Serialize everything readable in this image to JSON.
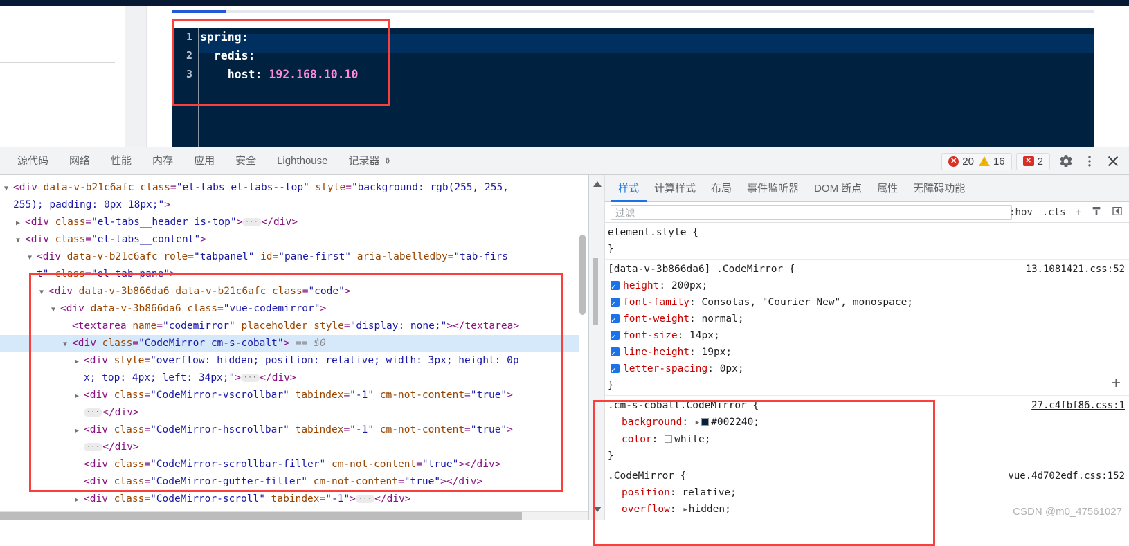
{
  "page": {
    "editor": {
      "theme_class": "cm-s-cobalt",
      "background": "#002240",
      "lines": [
        {
          "num": "1",
          "key": "spring:",
          "value": ""
        },
        {
          "num": "2",
          "key": "  redis:",
          "value": ""
        },
        {
          "num": "3",
          "key": "    host: ",
          "value": "192.168.10.10"
        }
      ]
    }
  },
  "devtools": {
    "tabs": [
      {
        "label": "源代码"
      },
      {
        "label": "网络"
      },
      {
        "label": "性能"
      },
      {
        "label": "内存"
      },
      {
        "label": "应用"
      },
      {
        "label": "安全"
      },
      {
        "label": "Lighthouse"
      },
      {
        "label": "记录器",
        "icon": "⚱"
      }
    ],
    "counters": {
      "errors": "20",
      "warnings": "16",
      "issues": "2",
      "error_glyph": "✕",
      "warning_glyph": "!",
      "issue_glyph": "✕"
    },
    "actions": {
      "settings": "⚙",
      "more": "⋮",
      "close": "✕"
    },
    "dom_tree": [
      {
        "indent": 0,
        "twisty": "▼",
        "segments": [
          {
            "t": "pt",
            "s": "<"
          },
          {
            "t": "tg",
            "s": "div"
          },
          {
            "t": "plain",
            "s": " "
          },
          {
            "t": "at",
            "s": "data-v-b21c6afc"
          },
          {
            "t": "plain",
            "s": " "
          },
          {
            "t": "at",
            "s": "class"
          },
          {
            "t": "pt",
            "s": "="
          },
          {
            "t": "av",
            "s": "\"el-tabs el-tabs--top\""
          },
          {
            "t": "plain",
            "s": " "
          },
          {
            "t": "at",
            "s": "style"
          },
          {
            "t": "pt",
            "s": "="
          },
          {
            "t": "av",
            "s": "\"background: rgb(255, 255,"
          }
        ]
      },
      {
        "indent": 0,
        "twisty": "",
        "segments": [
          {
            "t": "av",
            "s": "255); padding: 0px 18px;\""
          },
          {
            "t": "pt",
            "s": ">"
          }
        ]
      },
      {
        "indent": 1,
        "twisty": "▶",
        "segments": [
          {
            "t": "pt",
            "s": "<"
          },
          {
            "t": "tg",
            "s": "div"
          },
          {
            "t": "plain",
            "s": " "
          },
          {
            "t": "at",
            "s": "class"
          },
          {
            "t": "pt",
            "s": "="
          },
          {
            "t": "av",
            "s": "\"el-tabs__header is-top\""
          },
          {
            "t": "pt",
            "s": ">"
          },
          {
            "t": "ell",
            "s": "…"
          },
          {
            "t": "pt",
            "s": "</"
          },
          {
            "t": "tg",
            "s": "div"
          },
          {
            "t": "pt",
            "s": ">"
          }
        ]
      },
      {
        "indent": 1,
        "twisty": "▼",
        "segments": [
          {
            "t": "pt",
            "s": "<"
          },
          {
            "t": "tg",
            "s": "div"
          },
          {
            "t": "plain",
            "s": " "
          },
          {
            "t": "at",
            "s": "class"
          },
          {
            "t": "pt",
            "s": "="
          },
          {
            "t": "av",
            "s": "\"el-tabs__content\""
          },
          {
            "t": "pt",
            "s": ">"
          }
        ]
      },
      {
        "indent": 2,
        "twisty": "▼",
        "segments": [
          {
            "t": "pt",
            "s": "<"
          },
          {
            "t": "tg",
            "s": "div"
          },
          {
            "t": "plain",
            "s": " "
          },
          {
            "t": "at",
            "s": "data-v-b21c6afc"
          },
          {
            "t": "plain",
            "s": " "
          },
          {
            "t": "at",
            "s": "role"
          },
          {
            "t": "pt",
            "s": "="
          },
          {
            "t": "av",
            "s": "\"tabpanel\""
          },
          {
            "t": "plain",
            "s": " "
          },
          {
            "t": "at",
            "s": "id"
          },
          {
            "t": "pt",
            "s": "="
          },
          {
            "t": "av",
            "s": "\"pane-first\""
          },
          {
            "t": "plain",
            "s": " "
          },
          {
            "t": "at",
            "s": "aria-labelledby"
          },
          {
            "t": "pt",
            "s": "="
          },
          {
            "t": "av",
            "s": "\"tab-firs"
          }
        ]
      },
      {
        "indent": 2,
        "twisty": "",
        "segments": [
          {
            "t": "av",
            "s": "t\""
          },
          {
            "t": "plain",
            "s": " "
          },
          {
            "t": "at",
            "s": "class"
          },
          {
            "t": "pt",
            "s": "="
          },
          {
            "t": "av",
            "s": "\"el-tab-pane\""
          },
          {
            "t": "pt",
            "s": ">"
          }
        ]
      },
      {
        "indent": 3,
        "twisty": "▼",
        "segments": [
          {
            "t": "pt",
            "s": "<"
          },
          {
            "t": "tg",
            "s": "div"
          },
          {
            "t": "plain",
            "s": " "
          },
          {
            "t": "at",
            "s": "data-v-3b866da6"
          },
          {
            "t": "plain",
            "s": " "
          },
          {
            "t": "at",
            "s": "data-v-b21c6afc"
          },
          {
            "t": "plain",
            "s": " "
          },
          {
            "t": "at",
            "s": "class"
          },
          {
            "t": "pt",
            "s": "="
          },
          {
            "t": "av",
            "s": "\"code\""
          },
          {
            "t": "pt",
            "s": ">"
          }
        ]
      },
      {
        "indent": 4,
        "twisty": "▼",
        "segments": [
          {
            "t": "pt",
            "s": "<"
          },
          {
            "t": "tg",
            "s": "div"
          },
          {
            "t": "plain",
            "s": " "
          },
          {
            "t": "at",
            "s": "data-v-3b866da6"
          },
          {
            "t": "plain",
            "s": " "
          },
          {
            "t": "at",
            "s": "class"
          },
          {
            "t": "pt",
            "s": "="
          },
          {
            "t": "av",
            "s": "\"vue-codemirror\""
          },
          {
            "t": "pt",
            "s": ">"
          }
        ]
      },
      {
        "indent": 5,
        "twisty": "",
        "segments": [
          {
            "t": "pt",
            "s": "<"
          },
          {
            "t": "tg",
            "s": "textarea"
          },
          {
            "t": "plain",
            "s": " "
          },
          {
            "t": "at",
            "s": "name"
          },
          {
            "t": "pt",
            "s": "="
          },
          {
            "t": "av",
            "s": "\"codemirror\""
          },
          {
            "t": "plain",
            "s": " "
          },
          {
            "t": "at",
            "s": "placeholder"
          },
          {
            "t": "plain",
            "s": " "
          },
          {
            "t": "at",
            "s": "style"
          },
          {
            "t": "pt",
            "s": "="
          },
          {
            "t": "av",
            "s": "\"display: none;\""
          },
          {
            "t": "pt",
            "s": "></"
          },
          {
            "t": "tg",
            "s": "textarea"
          },
          {
            "t": "pt",
            "s": ">"
          }
        ]
      },
      {
        "indent": 5,
        "twisty": "▼",
        "selected": true,
        "segments": [
          {
            "t": "pt",
            "s": "<"
          },
          {
            "t": "tg",
            "s": "div"
          },
          {
            "t": "plain",
            "s": " "
          },
          {
            "t": "at",
            "s": "class"
          },
          {
            "t": "pt",
            "s": "="
          },
          {
            "t": "av",
            "s": "\"CodeMirror cm-s-cobalt\""
          },
          {
            "t": "pt",
            "s": ">"
          },
          {
            "t": "eq",
            "s": " == $0"
          }
        ]
      },
      {
        "indent": 6,
        "twisty": "▶",
        "segments": [
          {
            "t": "pt",
            "s": "<"
          },
          {
            "t": "tg",
            "s": "div"
          },
          {
            "t": "plain",
            "s": " "
          },
          {
            "t": "at",
            "s": "style"
          },
          {
            "t": "pt",
            "s": "="
          },
          {
            "t": "av",
            "s": "\"overflow: hidden; position: relative; width: 3px; height: 0p"
          }
        ]
      },
      {
        "indent": 6,
        "twisty": "",
        "segments": [
          {
            "t": "av",
            "s": "x; top: 4px; left: 34px;\""
          },
          {
            "t": "pt",
            "s": ">"
          },
          {
            "t": "ell",
            "s": "…"
          },
          {
            "t": "pt",
            "s": "</"
          },
          {
            "t": "tg",
            "s": "div"
          },
          {
            "t": "pt",
            "s": ">"
          }
        ]
      },
      {
        "indent": 6,
        "twisty": "▶",
        "segments": [
          {
            "t": "pt",
            "s": "<"
          },
          {
            "t": "tg",
            "s": "div"
          },
          {
            "t": "plain",
            "s": " "
          },
          {
            "t": "at",
            "s": "class"
          },
          {
            "t": "pt",
            "s": "="
          },
          {
            "t": "av",
            "s": "\"CodeMirror-vscrollbar\""
          },
          {
            "t": "plain",
            "s": " "
          },
          {
            "t": "at",
            "s": "tabindex"
          },
          {
            "t": "pt",
            "s": "="
          },
          {
            "t": "av",
            "s": "\"-1\""
          },
          {
            "t": "plain",
            "s": " "
          },
          {
            "t": "at",
            "s": "cm-not-content"
          },
          {
            "t": "pt",
            "s": "="
          },
          {
            "t": "av",
            "s": "\"true\""
          },
          {
            "t": "pt",
            "s": ">"
          }
        ]
      },
      {
        "indent": 6,
        "twisty": "",
        "segments": [
          {
            "t": "ell",
            "s": "…"
          },
          {
            "t": "pt",
            "s": "</"
          },
          {
            "t": "tg",
            "s": "div"
          },
          {
            "t": "pt",
            "s": ">"
          }
        ]
      },
      {
        "indent": 6,
        "twisty": "▶",
        "segments": [
          {
            "t": "pt",
            "s": "<"
          },
          {
            "t": "tg",
            "s": "div"
          },
          {
            "t": "plain",
            "s": " "
          },
          {
            "t": "at",
            "s": "class"
          },
          {
            "t": "pt",
            "s": "="
          },
          {
            "t": "av",
            "s": "\"CodeMirror-hscrollbar\""
          },
          {
            "t": "plain",
            "s": " "
          },
          {
            "t": "at",
            "s": "tabindex"
          },
          {
            "t": "pt",
            "s": "="
          },
          {
            "t": "av",
            "s": "\"-1\""
          },
          {
            "t": "plain",
            "s": " "
          },
          {
            "t": "at",
            "s": "cm-not-content"
          },
          {
            "t": "pt",
            "s": "="
          },
          {
            "t": "av",
            "s": "\"true\""
          },
          {
            "t": "pt",
            "s": ">"
          }
        ]
      },
      {
        "indent": 6,
        "twisty": "",
        "segments": [
          {
            "t": "ell",
            "s": "…"
          },
          {
            "t": "pt",
            "s": "</"
          },
          {
            "t": "tg",
            "s": "div"
          },
          {
            "t": "pt",
            "s": ">"
          }
        ]
      },
      {
        "indent": 6,
        "twisty": "",
        "segments": [
          {
            "t": "pt",
            "s": "<"
          },
          {
            "t": "tg",
            "s": "div"
          },
          {
            "t": "plain",
            "s": " "
          },
          {
            "t": "at",
            "s": "class"
          },
          {
            "t": "pt",
            "s": "="
          },
          {
            "t": "av",
            "s": "\"CodeMirror-scrollbar-filler\""
          },
          {
            "t": "plain",
            "s": " "
          },
          {
            "t": "at",
            "s": "cm-not-content"
          },
          {
            "t": "pt",
            "s": "="
          },
          {
            "t": "av",
            "s": "\"true\""
          },
          {
            "t": "pt",
            "s": "></"
          },
          {
            "t": "tg",
            "s": "div"
          },
          {
            "t": "pt",
            "s": ">"
          }
        ]
      },
      {
        "indent": 6,
        "twisty": "",
        "segments": [
          {
            "t": "pt",
            "s": "<"
          },
          {
            "t": "tg",
            "s": "div"
          },
          {
            "t": "plain",
            "s": " "
          },
          {
            "t": "at",
            "s": "class"
          },
          {
            "t": "pt",
            "s": "="
          },
          {
            "t": "av",
            "s": "\"CodeMirror-gutter-filler\""
          },
          {
            "t": "plain",
            "s": " "
          },
          {
            "t": "at",
            "s": "cm-not-content"
          },
          {
            "t": "pt",
            "s": "="
          },
          {
            "t": "av",
            "s": "\"true\""
          },
          {
            "t": "pt",
            "s": "></"
          },
          {
            "t": "tg",
            "s": "div"
          },
          {
            "t": "pt",
            "s": ">"
          }
        ]
      },
      {
        "indent": 6,
        "twisty": "▶",
        "segments": [
          {
            "t": "pt",
            "s": "<"
          },
          {
            "t": "tg",
            "s": "div"
          },
          {
            "t": "plain",
            "s": " "
          },
          {
            "t": "at",
            "s": "class"
          },
          {
            "t": "pt",
            "s": "="
          },
          {
            "t": "av",
            "s": "\"CodeMirror-scroll\""
          },
          {
            "t": "plain",
            "s": " "
          },
          {
            "t": "at",
            "s": "tabindex"
          },
          {
            "t": "pt",
            "s": "="
          },
          {
            "t": "av",
            "s": "\"-1\""
          },
          {
            "t": "pt",
            "s": ">"
          },
          {
            "t": "ell",
            "s": "…"
          },
          {
            "t": "pt",
            "s": "</"
          },
          {
            "t": "tg",
            "s": "div"
          },
          {
            "t": "pt",
            "s": ">"
          }
        ]
      }
    ],
    "styles": {
      "tabs": [
        {
          "label": "样式",
          "active": true
        },
        {
          "label": "计算样式",
          "active": false
        },
        {
          "label": "布局",
          "active": false
        },
        {
          "label": "事件监听器",
          "active": false
        },
        {
          "label": "DOM 断点",
          "active": false
        },
        {
          "label": "属性",
          "active": false
        },
        {
          "label": "无障碍功能",
          "active": false
        }
      ],
      "filter_placeholder": "过滤",
      "filter_value": "",
      "toolbar": [
        {
          "label": ":hov"
        },
        {
          "label": ".cls"
        },
        {
          "label": "+"
        },
        {
          "label": "🖫"
        },
        {
          "label": "◁"
        }
      ],
      "rules": [
        {
          "selector": "element.style {",
          "source": "",
          "declarations": [],
          "close": "}"
        },
        {
          "selector": "[data-v-3b866da6] .CodeMirror {",
          "source": "13.1081421.css:52",
          "declarations": [
            {
              "checkbox": true,
              "prop": "height",
              "value": "200px;"
            },
            {
              "checkbox": true,
              "prop": "font-family",
              "value": "Consolas, \"Courier New\", monospace;"
            },
            {
              "checkbox": true,
              "prop": "font-weight",
              "value": "normal;"
            },
            {
              "checkbox": true,
              "prop": "font-size",
              "value": "14px;"
            },
            {
              "checkbox": true,
              "prop": "line-height",
              "value": "19px;"
            },
            {
              "checkbox": true,
              "prop": "letter-spacing",
              "value": "0px;"
            }
          ],
          "close": "}"
        },
        {
          "selector": ".cm-s-cobalt.CodeMirror {",
          "source": "27.c4fbf86.css:1",
          "declarations": [
            {
              "checkbox": false,
              "prop": "background",
              "value": "#002240;",
              "swatch": "#002240",
              "expandable": true
            },
            {
              "checkbox": false,
              "prop": "color",
              "value": "white;",
              "swatch": "#ffffff"
            }
          ],
          "close": "}"
        },
        {
          "selector": ".CodeMirror {",
          "source": "vue.4d702edf.css:152",
          "declarations": [
            {
              "checkbox": false,
              "prop": "position",
              "value": "relative;"
            },
            {
              "checkbox": false,
              "prop": "overflow",
              "value": "hidden;",
              "expandable": true
            }
          ],
          "close": ""
        }
      ],
      "add_rule_label": "+"
    },
    "watermark": "CSDN @m0_47561027"
  }
}
